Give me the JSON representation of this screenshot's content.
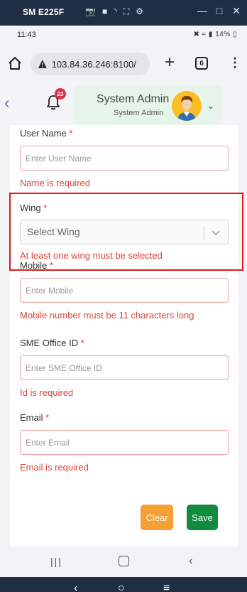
{
  "mirror": {
    "device_name": "SM E225F"
  },
  "status": {
    "time": "11:43",
    "battery": "14%"
  },
  "browser": {
    "url": "103.84.36.246:8100/",
    "tab_count": "6"
  },
  "header": {
    "notification_count": "23",
    "user_name": "System Admin",
    "user_role": "System Admin"
  },
  "form": {
    "user_name": {
      "label": "User Name",
      "required_mark": "*",
      "placeholder": "Enter User Name",
      "error": "Name is required"
    },
    "wing": {
      "label": "Wing",
      "required_mark": "*",
      "placeholder": "Select Wing",
      "error": "At least one wing must be selected"
    },
    "mobile": {
      "label": "Mobile",
      "required_mark": "*",
      "placeholder": "Enter Mobile",
      "error": "Mobile number must be 11 characters long"
    },
    "sme_office_id": {
      "label": "SME Office ID",
      "required_mark": "*",
      "placeholder": "Enter SME Office ID",
      "error": "Id is required"
    },
    "email": {
      "label": "Email",
      "required_mark": "*",
      "placeholder": "Enter Email",
      "error": "Email is required"
    },
    "clear_label": "Clear",
    "save_label": "Save"
  },
  "colors": {
    "error": "#d9453d",
    "clear_button": "#f4a035",
    "save_button": "#0f8a3e",
    "highlight": "#e01c1c"
  }
}
